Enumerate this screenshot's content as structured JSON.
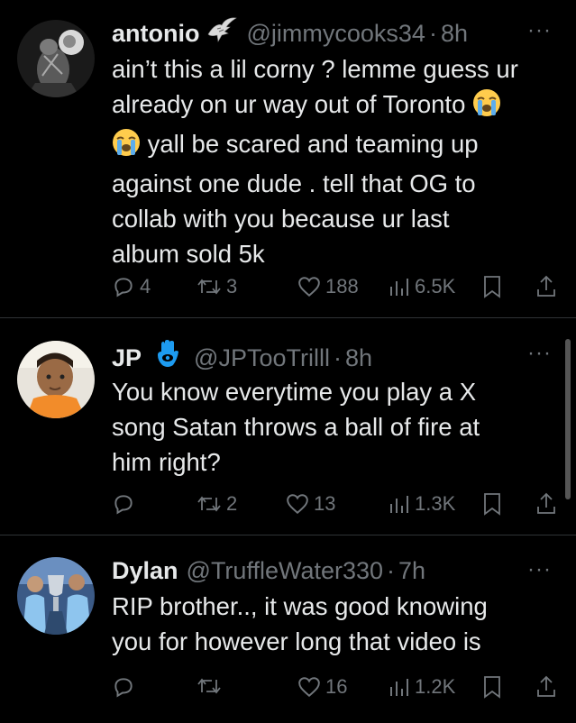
{
  "tweets": [
    {
      "name": "antonio",
      "handle": "@jimmycooks34",
      "time": "8h",
      "body": [
        "ain’t this a lil corny ? lemme guess ur",
        "already on ur way out of Toronto",
        "yall be scared and teaming up",
        "against one dude . tell that OG to",
        "collab with you because ur last",
        "album sold 5k"
      ],
      "replies": "4",
      "retweets": "3",
      "likes": "188",
      "views": "6.5K"
    },
    {
      "name": "JP",
      "handle": "@JPTooTrilll",
      "time": "8h",
      "body": [
        "You know everytime you play a X",
        "song Satan throws a ball of fire at",
        "him right?"
      ],
      "replies": "",
      "retweets": "2",
      "likes": "13",
      "views": "1.3K"
    },
    {
      "name": "Dylan",
      "handle": "@TruffleWater330",
      "time": "7h",
      "body": [
        "RIP brother.., it was good knowing",
        "you for however long that video is"
      ],
      "replies": "",
      "retweets": "",
      "likes": "16",
      "views": "1.2K"
    }
  ],
  "separator": "·",
  "more_label": "···",
  "icons": {
    "reply": "reply-icon",
    "retweet": "retweet-icon",
    "like": "heart-icon",
    "views": "views-icon",
    "bookmark": "bookmark-icon",
    "share": "share-icon",
    "emoji": "loudly-crying-face-emoji",
    "badge1": "eagle-badge-icon",
    "badge2": "hamsa-badge-icon"
  },
  "colors": {
    "background": "#000000",
    "text": "#e7e9ea",
    "muted": "#71767b",
    "divider": "#2f3336",
    "hamsa": "#1d9bf0"
  }
}
